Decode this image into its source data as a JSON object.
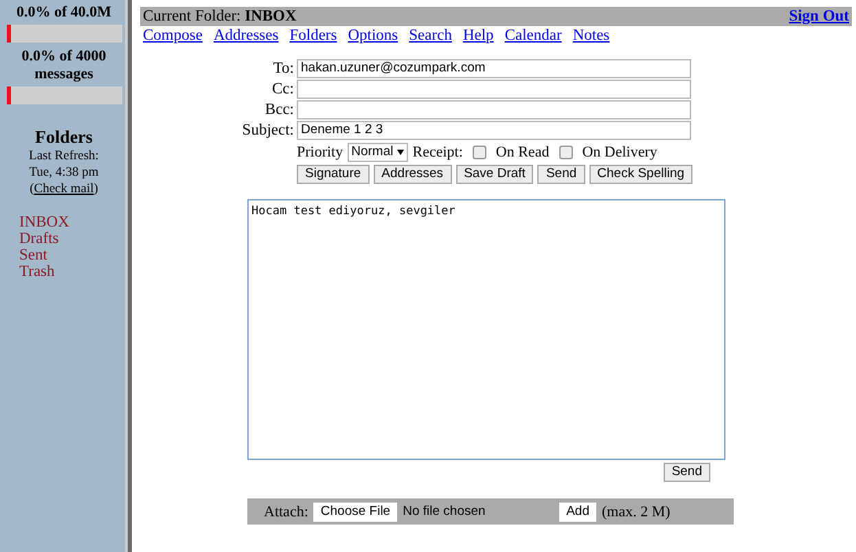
{
  "sidebar": {
    "quotas": [
      {
        "label": "0.0% of 40.0M",
        "level": 0
      },
      {
        "label": "0.0% of 4000 messages",
        "level": 0
      }
    ],
    "folders_title": "Folders",
    "last_refresh": "Last Refresh:",
    "refresh_time": "Tue, 4:38 pm",
    "check_mail_open": "(",
    "check_mail": "Check mail",
    "check_mail_close": ")",
    "folders": [
      "INBOX",
      "Drafts",
      "Sent",
      "Trash"
    ]
  },
  "top_bar": {
    "label": "Current Folder:",
    "folder": "INBOX",
    "sign_out": "Sign Out"
  },
  "nav": [
    "Compose",
    "Addresses",
    "Folders",
    "Options",
    "Search",
    "Help",
    "Calendar",
    "Notes"
  ],
  "fields": [
    {
      "label": "To:",
      "value": "hakan.uzuner@cozumpark.com"
    },
    {
      "label": "Cc:"
    },
    {
      "label": "Bcc:"
    },
    {
      "label": "Subject:",
      "value": "Deneme 1 2 3"
    }
  ],
  "priority": {
    "label": "Priority",
    "value": "Normal",
    "receipt": "Receipt:",
    "options": [
      {
        "label": "On Read",
        "checked": false
      },
      {
        "label": "On Delivery",
        "checked": false
      }
    ]
  },
  "buttons": [
    "Signature",
    "Addresses",
    "Save Draft",
    "Send",
    "Check Spelling"
  ],
  "body": "Hocam test ediyoruz, sevgiler",
  "send": "Send",
  "attach": {
    "label": "Attach:",
    "choose": "Choose File",
    "status": "No file chosen",
    "add": "Add",
    "max": "(max. 2 M)"
  }
}
